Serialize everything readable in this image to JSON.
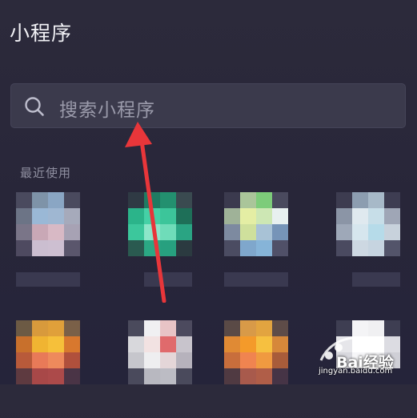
{
  "header": {
    "title": "小程序"
  },
  "search": {
    "placeholder": "搜索小程序"
  },
  "recent": {
    "section_label": "最近使用"
  },
  "icons": {
    "search": "search-icon"
  },
  "annotation": {
    "arrow_color": "#e8363a"
  },
  "watermark": {
    "brand": "Bai经验",
    "url": "jingyan.baidu.com"
  }
}
